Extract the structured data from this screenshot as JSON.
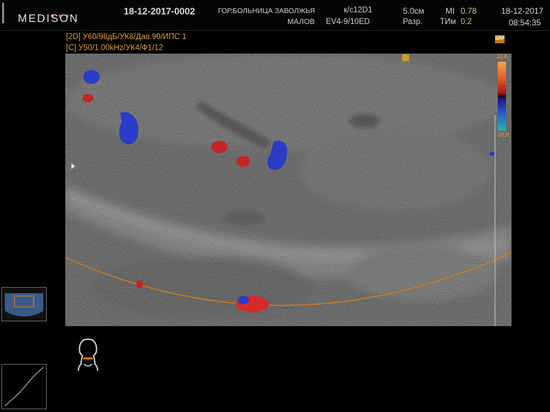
{
  "header": {
    "logo": "MEDISON",
    "patient_id": "18-12-2017-0002",
    "institution": "ГОР.БОЛЬНИЦА ЗАВОЛЖЬЯ",
    "operator": "МАЛОВ",
    "probe_line1": "к/с12D1",
    "probe_line2": "EV4-9/10ED",
    "depth": "5.0см",
    "depth_label": "Разр.",
    "mi_label": "MI",
    "mi_value": "0.78",
    "ti_label": "TИм",
    "ti_value": "0.2",
    "date": "18-12-2017",
    "time": "08:54:35",
    "logo_dot_colors": [
      "#e08a2a",
      "#e05030",
      "#3a7ad0"
    ]
  },
  "modes": {
    "line_2d": "[2D] У60/98дБ/УК8/Дав.90/ИПС 1",
    "line_color": "[C] У50/1.00kHz/УК4/Ф1/12"
  },
  "overlay": {
    "srf_label": "SRF",
    "colorbar_top": "10.8",
    "colorbar_bottom": "-10.8"
  },
  "colors": {
    "accent": "#d9a23c",
    "doppler_red": "#d42a2a",
    "doppler_blue": "#2a3cc8",
    "sector_line": "#d07a1a"
  }
}
